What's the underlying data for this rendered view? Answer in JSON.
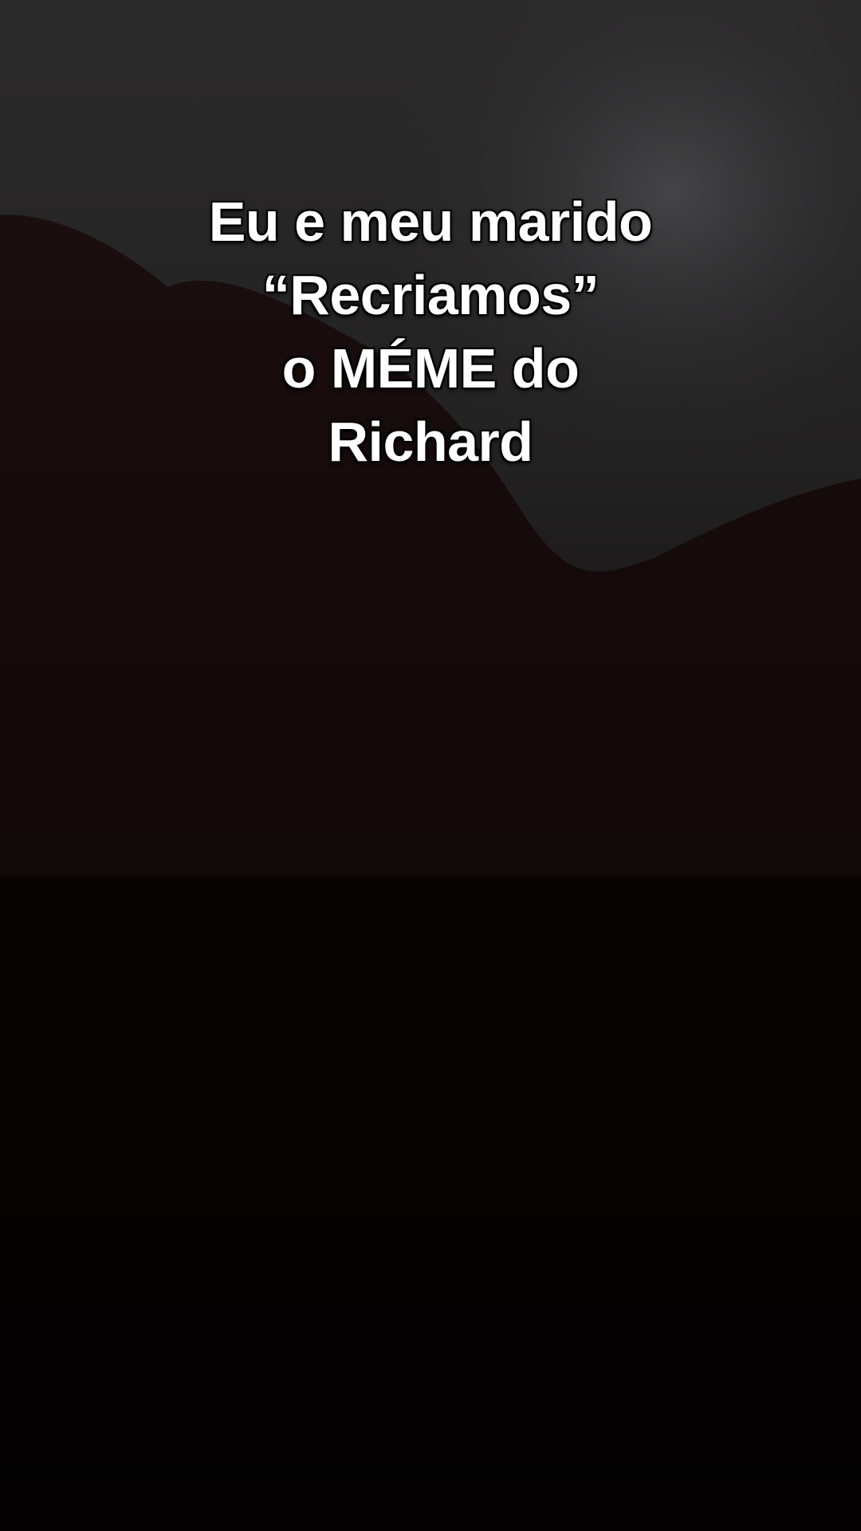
{
  "video": {
    "scene_description_icon": "dark-photo-background",
    "colors": {
      "sky_top": "#2b2a2a",
      "sky_mid": "#1f1e1e",
      "glow": "#4a4a4c",
      "silhouette": "#120909",
      "bottom": "#020101"
    }
  },
  "caption": {
    "lines": [
      "Eu e meu marido",
      "“Recriamos”",
      "o MÉME do",
      "Richard"
    ]
  }
}
